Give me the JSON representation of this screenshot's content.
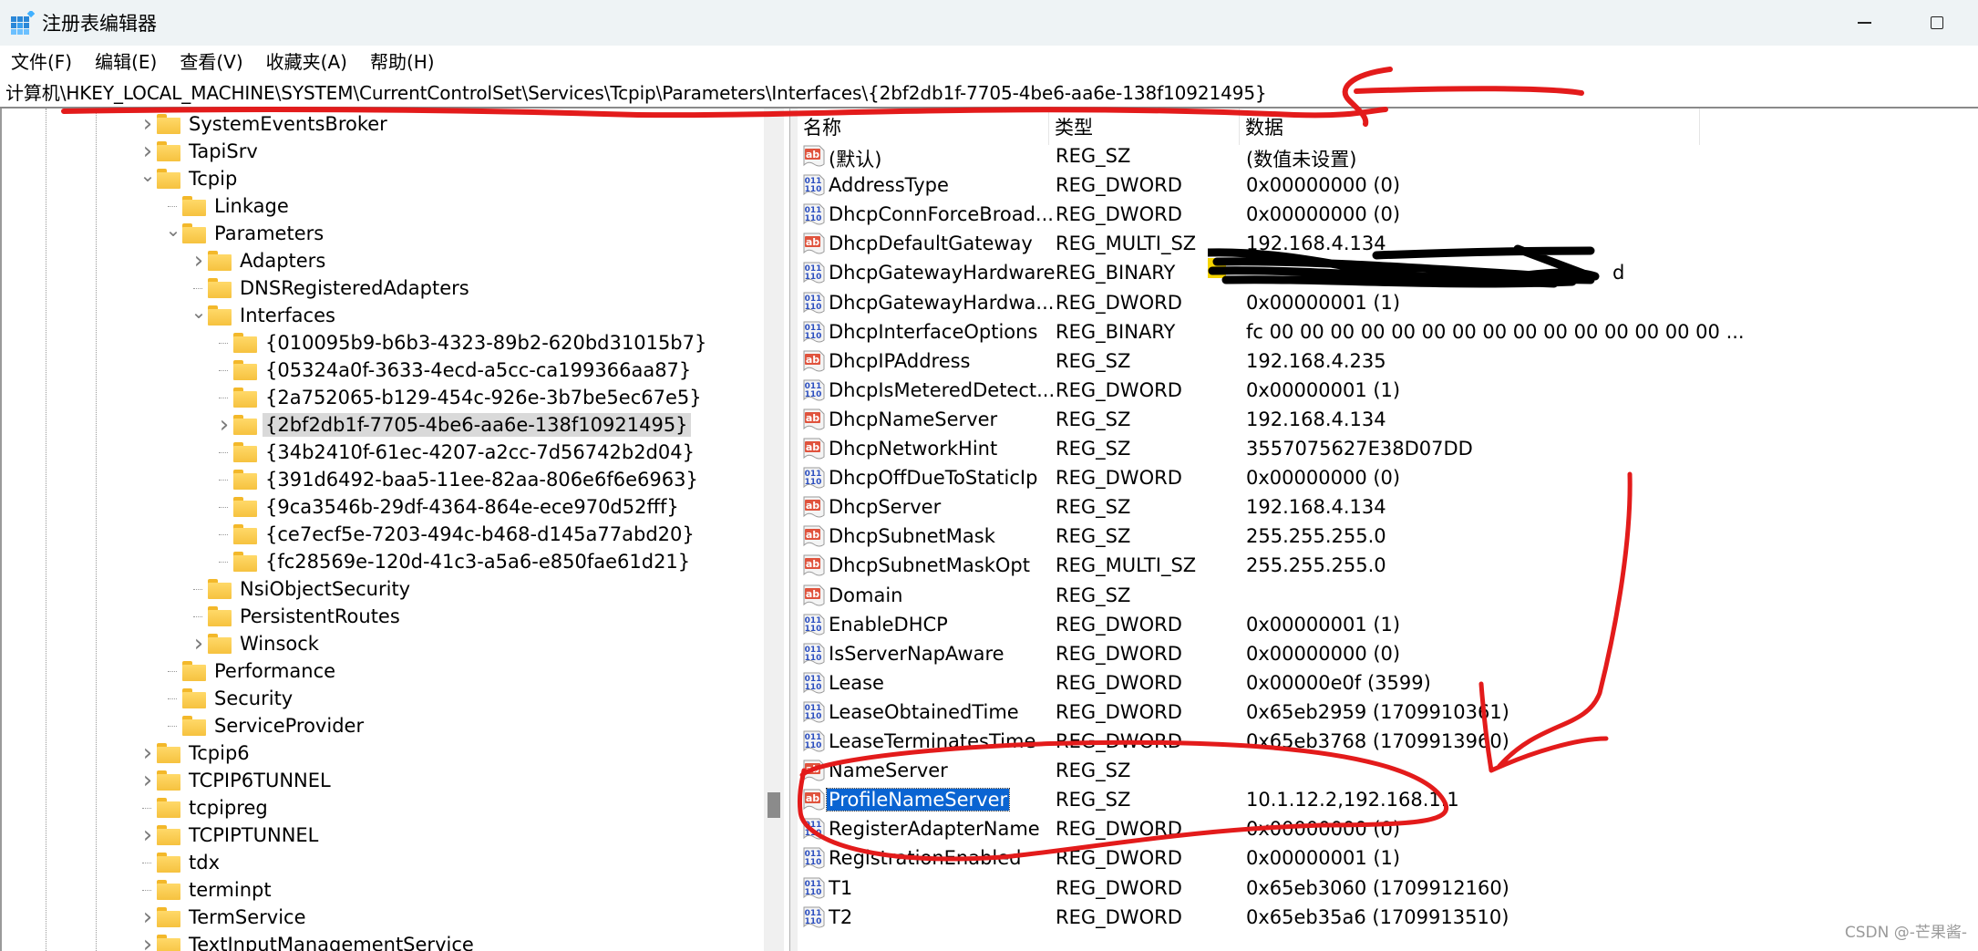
{
  "window": {
    "title": "注册表编辑器",
    "controls": {
      "minimize": "minimize",
      "maximize": "maximize"
    }
  },
  "menu": [
    "文件(F)",
    "编辑(E)",
    "查看(V)",
    "收藏夹(A)",
    "帮助(H)"
  ],
  "address": "计算机\\HKEY_LOCAL_MACHINE\\SYSTEM\\CurrentControlSet\\Services\\Tcpip\\Parameters\\Interfaces\\{2bf2db1f-7705-4be6-aa6e-138f10921495}",
  "tree": [
    {
      "label": "SystemEventsBroker",
      "level": 0,
      "expander": "collapsed"
    },
    {
      "label": "TapiSrv",
      "level": 0,
      "expander": "collapsed"
    },
    {
      "label": "Tcpip",
      "level": 0,
      "expander": "expanded"
    },
    {
      "label": "Linkage",
      "level": 1,
      "expander": "none"
    },
    {
      "label": "Parameters",
      "level": 1,
      "expander": "expanded"
    },
    {
      "label": "Adapters",
      "level": 2,
      "expander": "collapsed"
    },
    {
      "label": "DNSRegisteredAdapters",
      "level": 2,
      "expander": "none"
    },
    {
      "label": "Interfaces",
      "level": 2,
      "expander": "expanded"
    },
    {
      "label": "{010095b9-b6b3-4323-89b2-620bd31015b7}",
      "level": 3,
      "expander": "none"
    },
    {
      "label": "{05324a0f-3633-4ecd-a5cc-ca199366aa87}",
      "level": 3,
      "expander": "none"
    },
    {
      "label": "{2a752065-b129-454c-926e-3b7be5ec67e5}",
      "level": 3,
      "expander": "none"
    },
    {
      "label": "{2bf2db1f-7705-4be6-aa6e-138f10921495}",
      "level": 3,
      "expander": "collapsed",
      "selected": true
    },
    {
      "label": "{34b2410f-61ec-4207-a2cc-7d56742b2d04}",
      "level": 3,
      "expander": "none"
    },
    {
      "label": "{391d6492-baa5-11ee-82aa-806e6f6e6963}",
      "level": 3,
      "expander": "none"
    },
    {
      "label": "{9ca3546b-29df-4364-864e-ece970d52fff}",
      "level": 3,
      "expander": "none"
    },
    {
      "label": "{ce7ecf5e-7203-494c-b468-d145a77abd20}",
      "level": 3,
      "expander": "none"
    },
    {
      "label": "{fc28569e-120d-41c3-a5a6-e850fae61d21}",
      "level": 3,
      "expander": "none"
    },
    {
      "label": "NsiObjectSecurity",
      "level": 2,
      "expander": "none"
    },
    {
      "label": "PersistentRoutes",
      "level": 2,
      "expander": "none"
    },
    {
      "label": "Winsock",
      "level": 2,
      "expander": "collapsed"
    },
    {
      "label": "Performance",
      "level": 1,
      "expander": "none"
    },
    {
      "label": "Security",
      "level": 1,
      "expander": "none"
    },
    {
      "label": "ServiceProvider",
      "level": 1,
      "expander": "none"
    },
    {
      "label": "Tcpip6",
      "level": 0,
      "expander": "collapsed"
    },
    {
      "label": "TCPIP6TUNNEL",
      "level": 0,
      "expander": "collapsed"
    },
    {
      "label": "tcpipreg",
      "level": 0,
      "expander": "none"
    },
    {
      "label": "TCPIPTUNNEL",
      "level": 0,
      "expander": "collapsed"
    },
    {
      "label": "tdx",
      "level": 0,
      "expander": "none"
    },
    {
      "label": "terminpt",
      "level": 0,
      "expander": "none"
    },
    {
      "label": "TermService",
      "level": 0,
      "expander": "collapsed"
    },
    {
      "label": "TextInputManagementService",
      "level": 0,
      "expander": "collapsed"
    }
  ],
  "columns": {
    "name": "名称",
    "type": "类型",
    "data": "数据"
  },
  "values": [
    {
      "icon": "string",
      "name": "(默认)",
      "type": "REG_SZ",
      "data": "(数值未设置)"
    },
    {
      "icon": "binary",
      "name": "AddressType",
      "type": "REG_DWORD",
      "data": "0x00000000 (0)"
    },
    {
      "icon": "binary",
      "name": "DhcpConnForceBroad...",
      "type": "REG_DWORD",
      "data": "0x00000000 (0)"
    },
    {
      "icon": "string",
      "name": "DhcpDefaultGateway",
      "type": "REG_MULTI_SZ",
      "data": "192.168.4.134"
    },
    {
      "icon": "binary",
      "name": "DhcpGatewayHardware",
      "type": "REG_BINARY",
      "data": "[redacted] d"
    },
    {
      "icon": "binary",
      "name": "DhcpGatewayHardwa...",
      "type": "REG_DWORD",
      "data": "0x00000001 (1)"
    },
    {
      "icon": "binary",
      "name": "DhcpInterfaceOptions",
      "type": "REG_BINARY",
      "data": "fc 00 00 00 00 00 00 00 00 00 00 00 00 00 00 00 ..."
    },
    {
      "icon": "string",
      "name": "DhcpIPAddress",
      "type": "REG_SZ",
      "data": "192.168.4.235"
    },
    {
      "icon": "binary",
      "name": "DhcpIsMeteredDetect...",
      "type": "REG_DWORD",
      "data": "0x00000001 (1)"
    },
    {
      "icon": "string",
      "name": "DhcpNameServer",
      "type": "REG_SZ",
      "data": "192.168.4.134"
    },
    {
      "icon": "string",
      "name": "DhcpNetworkHint",
      "type": "REG_SZ",
      "data": "3557075627E38D07DD"
    },
    {
      "icon": "binary",
      "name": "DhcpOffDueToStaticIp",
      "type": "REG_DWORD",
      "data": "0x00000000 (0)"
    },
    {
      "icon": "string",
      "name": "DhcpServer",
      "type": "REG_SZ",
      "data": "192.168.4.134"
    },
    {
      "icon": "string",
      "name": "DhcpSubnetMask",
      "type": "REG_SZ",
      "data": "255.255.255.0"
    },
    {
      "icon": "string",
      "name": "DhcpSubnetMaskOpt",
      "type": "REG_MULTI_SZ",
      "data": "255.255.255.0"
    },
    {
      "icon": "string",
      "name": "Domain",
      "type": "REG_SZ",
      "data": ""
    },
    {
      "icon": "binary",
      "name": "EnableDHCP",
      "type": "REG_DWORD",
      "data": "0x00000001 (1)"
    },
    {
      "icon": "binary",
      "name": "IsServerNapAware",
      "type": "REG_DWORD",
      "data": "0x00000000 (0)"
    },
    {
      "icon": "binary",
      "name": "Lease",
      "type": "REG_DWORD",
      "data": "0x00000e0f (3599)"
    },
    {
      "icon": "binary",
      "name": "LeaseObtainedTime",
      "type": "REG_DWORD",
      "data": "0x65eb2959 (1709910361)"
    },
    {
      "icon": "binary",
      "name": "LeaseTerminatesTime",
      "type": "REG_DWORD",
      "data": "0x65eb3768 (1709913960)"
    },
    {
      "icon": "string",
      "name": "NameServer",
      "type": "REG_SZ",
      "data": ""
    },
    {
      "icon": "string",
      "name": "ProfileNameServer",
      "type": "REG_SZ",
      "data": "10.1.12.2,192.168.1.1",
      "selected": true
    },
    {
      "icon": "binary",
      "name": "RegisterAdapterName",
      "type": "REG_DWORD",
      "data": "0x00000000 (0)"
    },
    {
      "icon": "binary",
      "name": "RegistrationEnabled",
      "type": "REG_DWORD",
      "data": "0x00000001 (1)"
    },
    {
      "icon": "binary",
      "name": "T1",
      "type": "REG_DWORD",
      "data": "0x65eb3060 (1709912160)"
    },
    {
      "icon": "binary",
      "name": "T2",
      "type": "REG_DWORD",
      "data": "0x65eb35a6 (1709913510)"
    }
  ],
  "watermark": "CSDN @-芒果酱-",
  "colors": {
    "selection": "#0a64d2",
    "tree_selection": "#d9d9d9",
    "annotation_red": "#e31b1b",
    "folder": "#f6c23f"
  }
}
